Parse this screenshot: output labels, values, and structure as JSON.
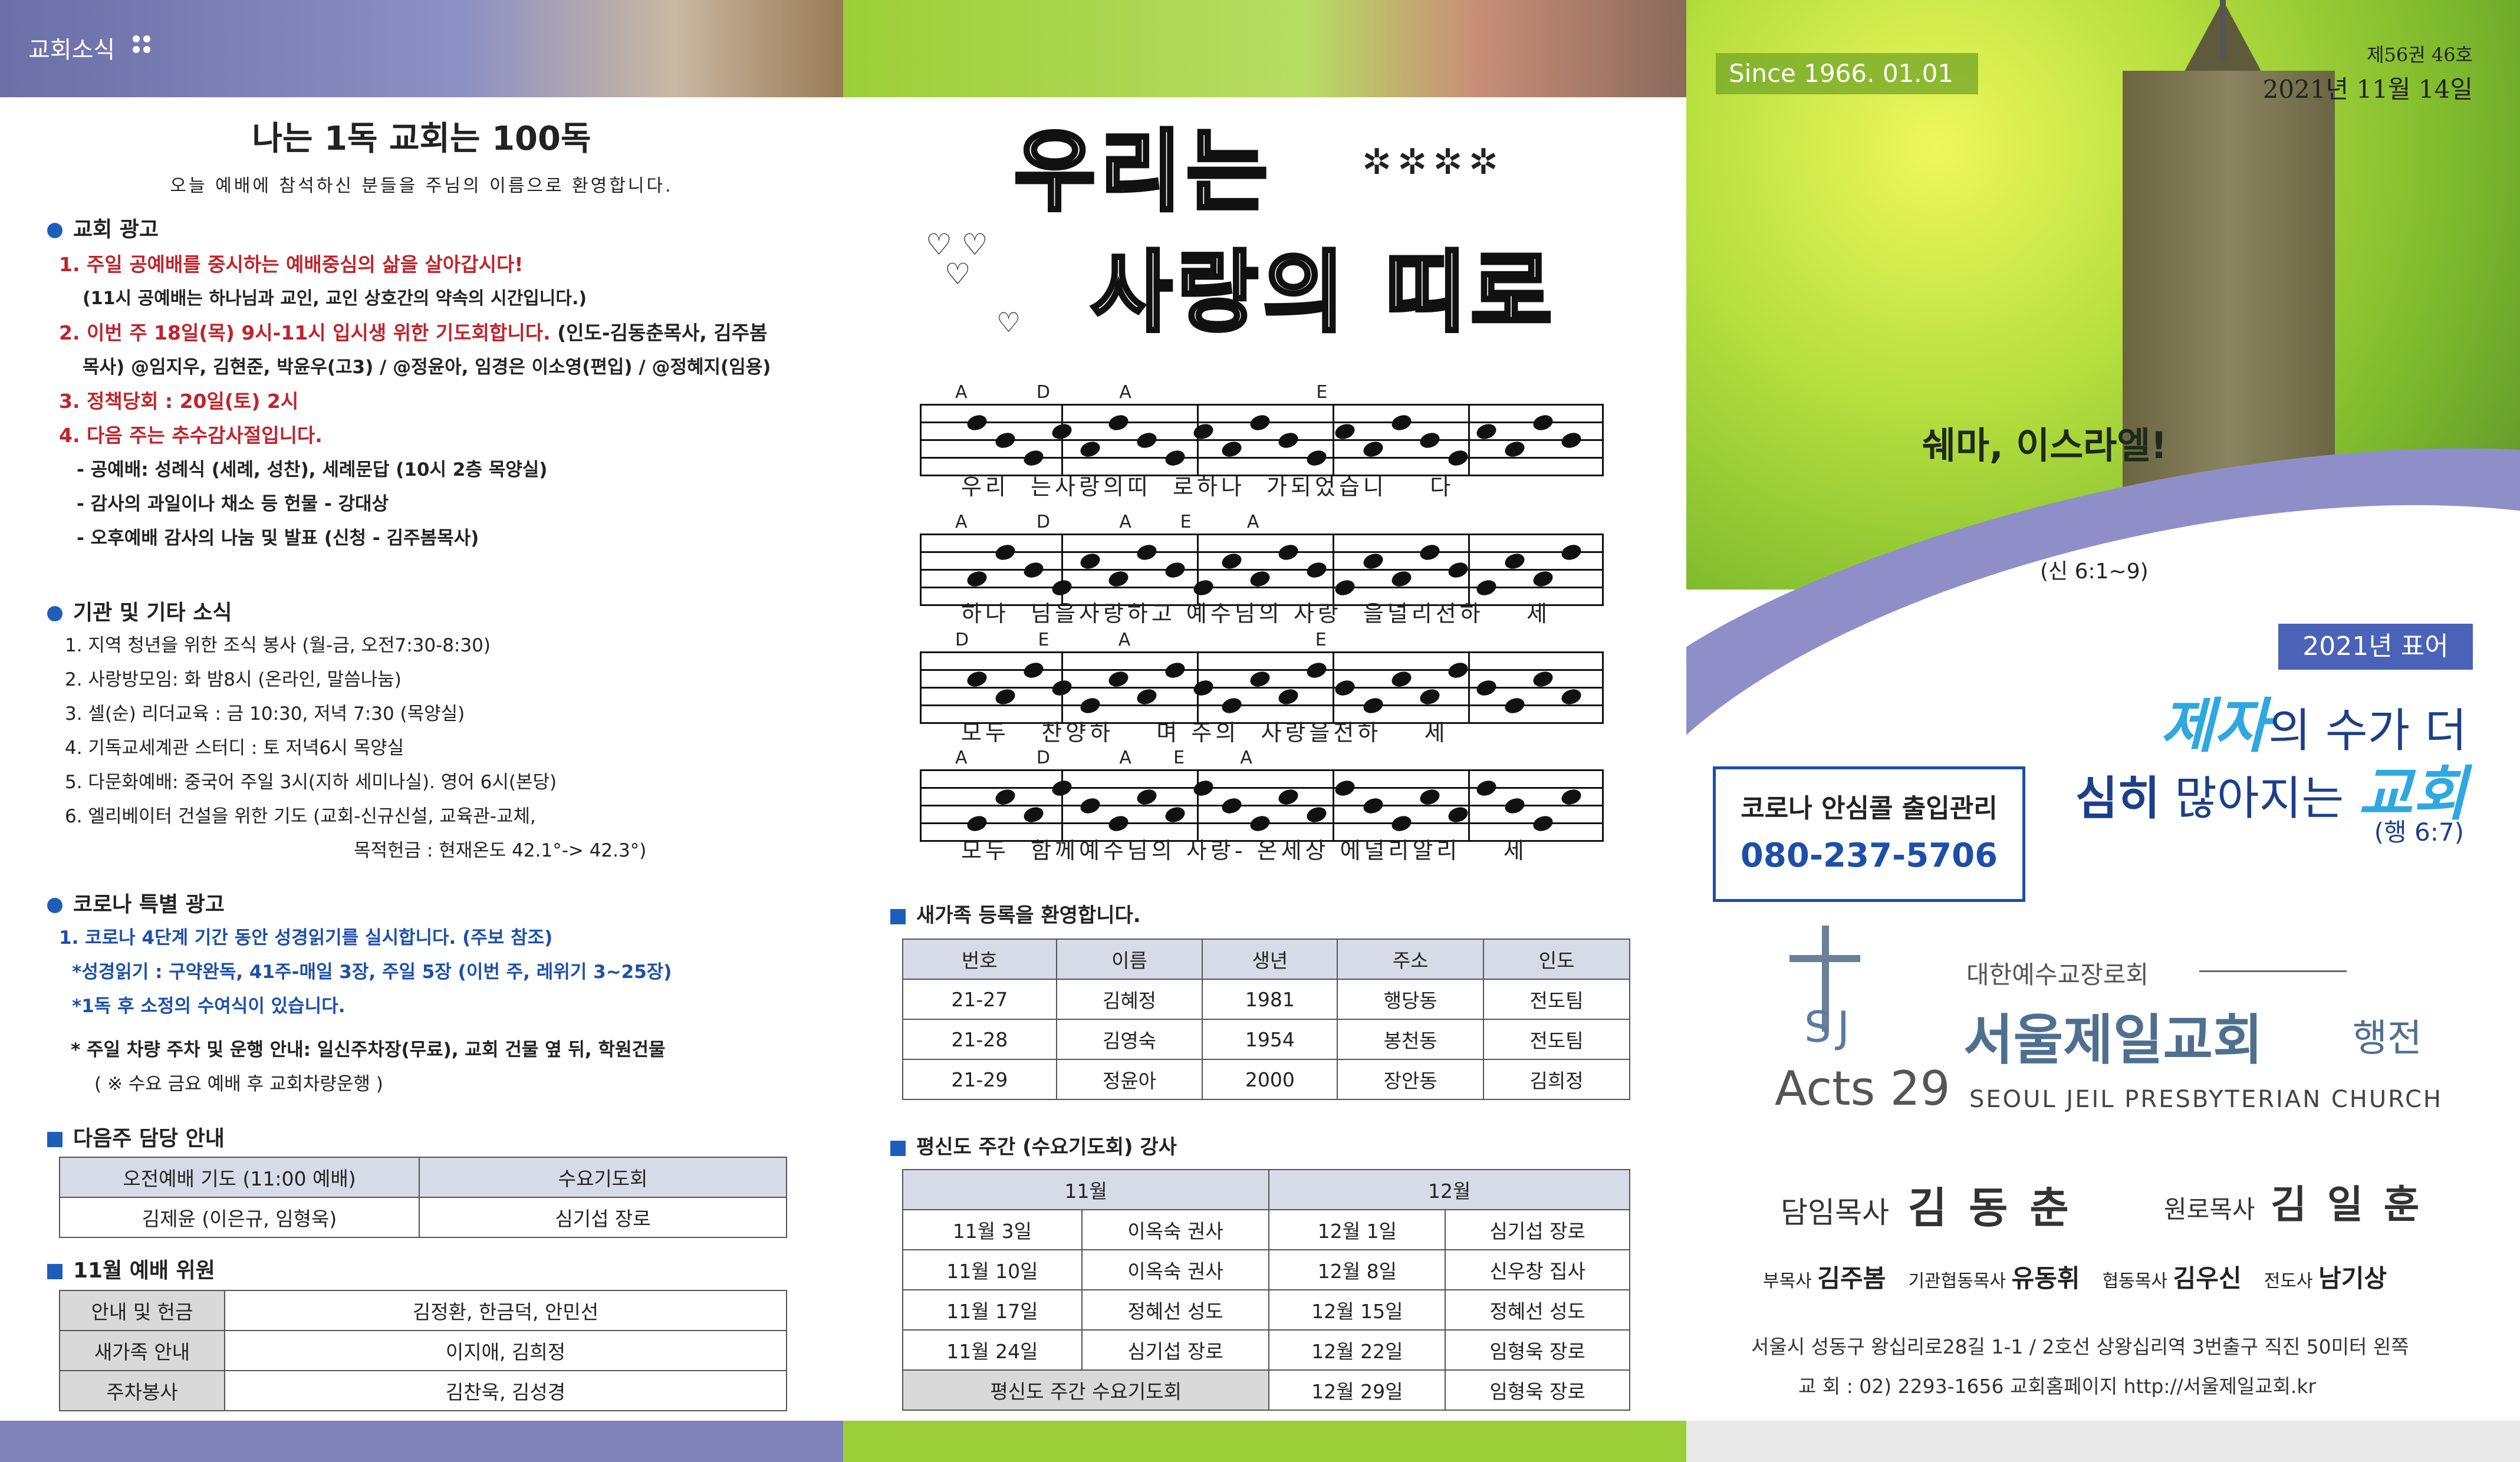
{
  "panel1": {
    "header_tag": "교회소식",
    "title": "나는 1독 교회는 100독",
    "subtitle": "오늘 예배에 참석하신 분들을 주님의 이름으로 환영합니다.",
    "ads_heading": "교회 광고",
    "ads": [
      {
        "text": "1. 주일 공예배를 중시하는 예배중심의 삶을 살아갑시다!",
        "style": "red"
      },
      {
        "text": "(11시 공예배는 하나님과 교인, 교인 상호간의 약속의 시간입니다.)",
        "style": "bold"
      },
      {
        "text": "2. 이번 주 18일(목) 9시-11시 입시생 위한 기도회합니다.",
        "style": "red",
        "tail": " (인도-김동춘목사, 김주봄"
      },
      {
        "text": "목사) @임지우, 김현준, 박윤우(고3) / @정윤아, 임경은 이소영(편입) / @정혜지(임용)",
        "style": "bold"
      },
      {
        "text": "3. 정책당회 : 20일(토) 2시",
        "style": "red"
      },
      {
        "text": "4. 다음 주는 추수감사절입니다.",
        "style": "red"
      },
      {
        "text": "- 공예배: 성례식 (세례, 성찬), 세례문답 (10시 2층 목양실)",
        "style": "bold"
      },
      {
        "text": "- 감사의 과일이나 채소 등 헌물 - 강대상",
        "style": "bold"
      },
      {
        "text": "- 오후예배 감사의 나눔 및 발표 (신청 - 김주봄목사)",
        "style": "bold"
      }
    ],
    "org_heading": "기관 및 기타 소식",
    "org": [
      "1. 지역 청년을 위한 조식 봉사 (월-금, 오전7:30-8:30)",
      "2. 사랑방모임: 화 밤8시 (온라인, 말씀나눔)",
      "3. 셀(순) 리더교육 : 금 10:30, 저녁 7:30 (목양실)",
      "4. 기독교세계관 스터디 : 토 저녁6시 목양실",
      "5. 다문화예배: 중국어 주일 3시(지하 세미나실). 영어 6시(본당)",
      "6. 엘리베이터 건설을 위한 기도 (교회-신규신설, 교육관-교체,",
      "목적헌금 : 현재온도 42.1°-> 42.3°)"
    ],
    "corona_heading": "코로나 특별 광고",
    "corona": [
      "1. 코로나 4단계 기간 동안 성경읽기를 실시합니다. (주보 참조)",
      "*성경읽기 : 구약완독, 41주-매일 3장, 주일 5장 (이번 주, 레위기 3~25장)",
      "*1독 후 소정의 수여식이 있습니다.",
      "* 주일 차량 주차 및 운행 안내: 일신주차장(무료), 교회 건물 옆 뒤, 학원건물",
      "( ※ 수요 금요 예배 후 교회차량운행 )"
    ],
    "next_heading": "다음주 담당 안내",
    "next_table": {
      "headers": [
        "오전예배 기도 (11:00 예배)",
        "수요기도회"
      ],
      "row": [
        "김제윤 (이은규, 임형욱)",
        "심기섭 장로"
      ]
    },
    "worship_heading": "11월 예배 위원",
    "worship_rows": [
      [
        "안내 및 헌금",
        "김정환, 한금덕, 안민선"
      ],
      [
        "새가족 안내",
        "이지애, 김희정"
      ],
      [
        "주차봉사",
        "김찬욱, 김성경"
      ]
    ]
  },
  "panel2": {
    "song_title_line1": "우리는",
    "song_title_line2": "사랑의 띠로",
    "staves": [
      {
        "chords": "A          D          A                           E",
        "lyrics": "우리  는사랑의띠  로하나  가되었습니    다"
      },
      {
        "chords": "A          D          A       E        A",
        "lyrics": "하나  님을사랑하고 예수님의 사랑  을널리전하    세"
      },
      {
        "chords": "D          E          A                           E",
        "lyrics": "모두   찬양하    며 주의  사랑을전하    세"
      },
      {
        "chords": "A          D          A      E        A",
        "lyrics": "모두  함께예수님의 사랑- 온세상 에널리알리    세"
      }
    ],
    "newfamily_heading": "새가족 등록을 환영합니다.",
    "newfamily": {
      "headers": [
        "번호",
        "이름",
        "생년",
        "주소",
        "인도"
      ],
      "rows": [
        [
          "21-27",
          "김혜정",
          "1981",
          "행당동",
          "전도팀"
        ],
        [
          "21-28",
          "김영숙",
          "1954",
          "봉천동",
          "전도팀"
        ],
        [
          "21-29",
          "정윤아",
          "2000",
          "장안동",
          "김희정"
        ]
      ]
    },
    "lay_heading": "평신도 주간 (수요기도회) 강사",
    "lay": {
      "months": [
        "11월",
        "12월"
      ],
      "rows": [
        [
          "11월 3일",
          "이옥숙 권사",
          "12월 1일",
          "심기섭 장로"
        ],
        [
          "11월 10일",
          "이옥숙 권사",
          "12월 8일",
          "신우창 집사"
        ],
        [
          "11월 17일",
          "정혜선 성도",
          "12월 15일",
          "정혜선 성도"
        ],
        [
          "11월 24일",
          "심기섭 장로",
          "12월 22일",
          "임형욱 장로"
        ],
        [
          "평신도 주간 수요기도회",
          "",
          "12월 29일",
          "임형욱 장로"
        ]
      ]
    }
  },
  "panel3": {
    "since": "Since 1966. 01.01",
    "volume": "제56권 46호",
    "date": "2021년 11월 14일",
    "shema": "쉐마, 이스라엘!",
    "shema_ref": "(신 6:1~9)",
    "motto_label": "2021년 표어",
    "motto_line1_a": "제자",
    "motto_line1_b": "의 수가 더",
    "motto_line2_a": "심히",
    "motto_line2_b": " 많아지는 ",
    "motto_line2_c": "교회",
    "motto_ref": "(행 6:7)",
    "corona_box_title": "코로나 안심콜 출입관리",
    "corona_box_phone": "080-237-5706",
    "denomination": "대한예수교장로회",
    "church_name": "서울제일교회",
    "church_suffix": "행전",
    "logo_letters": "SJ",
    "acts": "Acts 29",
    "english_name": "SEOUL JEIL PRESBYTERIAN CHURCH",
    "senior_label": "담임목사",
    "senior_name": "김 동 춘",
    "elder_label": "원로목사",
    "elder_name": "김 일 훈",
    "staff": [
      {
        "label": "부목사",
        "name": "김주봄"
      },
      {
        "label": "기관협동목사",
        "name": "유동휘"
      },
      {
        "label": "협동목사",
        "name": "김우신"
      },
      {
        "label": "전도사",
        "name": "남기상"
      }
    ],
    "address": "서울시 성동구 왕십리로28길 1-1 / 2호선 상왕십리역 3번출구 직진 50미터 왼쪽",
    "contact": "교 회 : 02) 2293-1656   교회홈페이지  http://서울제일교회.kr"
  }
}
